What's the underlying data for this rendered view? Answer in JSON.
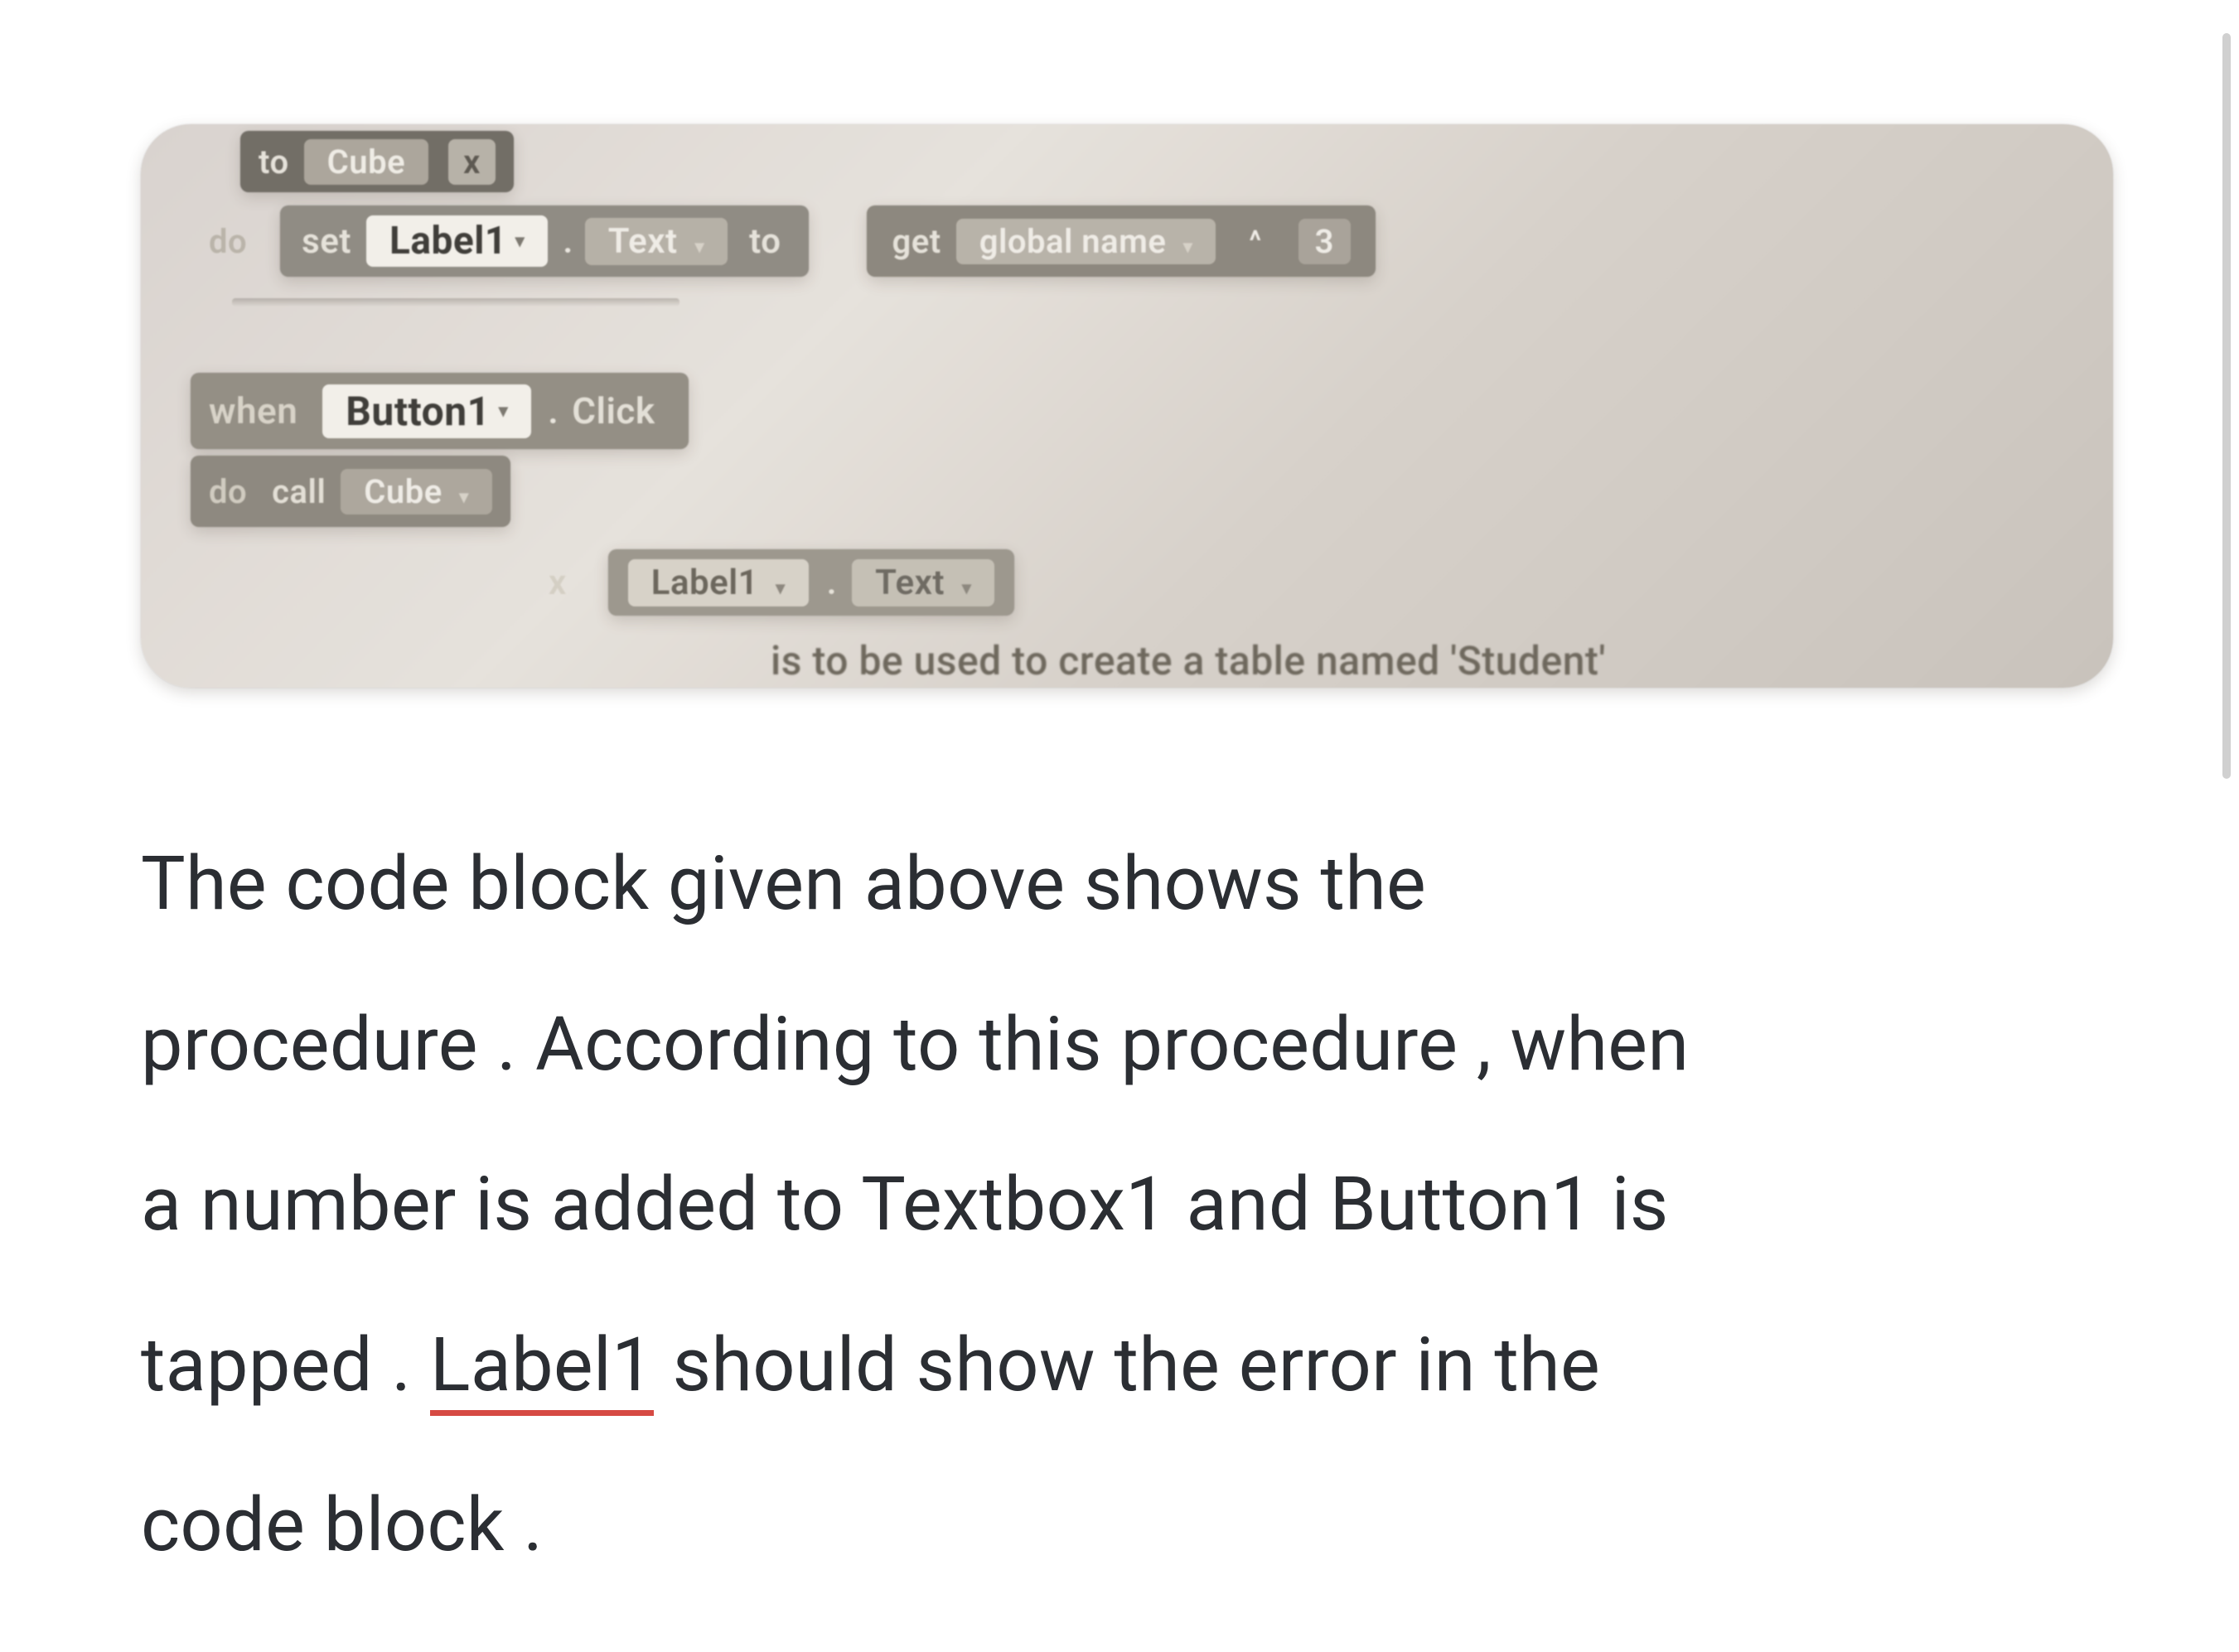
{
  "blocks": {
    "row_to_cube": {
      "kw_to": "to",
      "proc_name": "Cube",
      "arg_x": "x"
    },
    "row_do_set": {
      "kw_do": "do",
      "kw_set": "set",
      "component": "Label1",
      "property": "Text",
      "kw_to": "to",
      "kw_get": "get",
      "var": "global name",
      "operator": "^",
      "operand": "3"
    },
    "row_when": {
      "kw_when": "when",
      "component": "Button1",
      "event": "Click"
    },
    "row_call": {
      "kw_do": "do",
      "kw_call": "call",
      "proc_name": "Cube"
    },
    "row_arg": {
      "arg_label": "x",
      "component": "Label1",
      "property": "Text"
    },
    "peek_text": "is to be used to create a table named 'Student'"
  },
  "question": {
    "line1": "The code block given above shows the",
    "line2": "procedure . According to this procedure , when",
    "line3": "a number is added to Textbox1 and Button1 is",
    "line4_prefix": "tapped . ",
    "line4_underlined": "Label1",
    "line4_suffix": " should show the error in the",
    "line5": "code block ."
  },
  "colors": {
    "spell_underline": "#d64a43",
    "photo_tint": "#d8d2ce",
    "text": "#2b2e33"
  }
}
